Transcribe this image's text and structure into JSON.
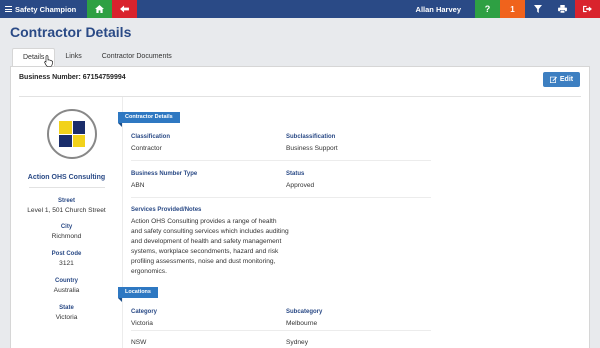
{
  "topbar": {
    "brand": "Safety Champion",
    "user": "Allan Harvey",
    "help": "?",
    "alert_count": "1",
    "icons": [
      "menu-icon",
      "home-icon",
      "back-arrow-icon",
      "help-icon",
      "alert-icon",
      "filter-icon",
      "print-icon",
      "logout-icon"
    ],
    "colors": {
      "bar": "#2a4a86",
      "green": "#2ea043",
      "red": "#d9232d",
      "orange": "#f0631c"
    }
  },
  "page_title": "Contractor Details",
  "tabs": [
    {
      "label": "Details",
      "active": true
    },
    {
      "label": "Links"
    },
    {
      "label": "Contractor Documents"
    }
  ],
  "business_number": "Business Number: 67154759994",
  "edit_label": "Edit",
  "profile": {
    "company": "Action OHS Consulting",
    "fields": [
      {
        "label": "Street",
        "value": "Level 1, 501 Church Street"
      },
      {
        "label": "City",
        "value": "Richmond"
      },
      {
        "label": "Post Code",
        "value": "3121"
      },
      {
        "label": "Country",
        "value": "Australia"
      },
      {
        "label": "State",
        "value": "Victoria"
      }
    ]
  },
  "contractor_details": {
    "ribbon": "Contractor Details",
    "classification_label": "Classification",
    "classification": "Contractor",
    "subclassification_label": "Subclassification",
    "subclassification": "Business Support",
    "bn_type_label": "Business Number Type",
    "bn_type": "ABN",
    "status_label": "Status",
    "status": "Approved",
    "services_label": "Services Provided/Notes",
    "services": "Action OHS Consulting provides a range of health and safety consulting services which includes auditing and development of health and safety management systems, workplace secondments, hazard and risk profiling assessments, noise and dust monitoring, ergonomics."
  },
  "locations": {
    "ribbon": "Locations",
    "category_label": "Category",
    "subcategory_label": "Subcategory",
    "rows": [
      {
        "category": "Victoria",
        "subcategory": "Melbourne"
      },
      {
        "category": "NSW",
        "subcategory": "Sydney"
      }
    ]
  }
}
